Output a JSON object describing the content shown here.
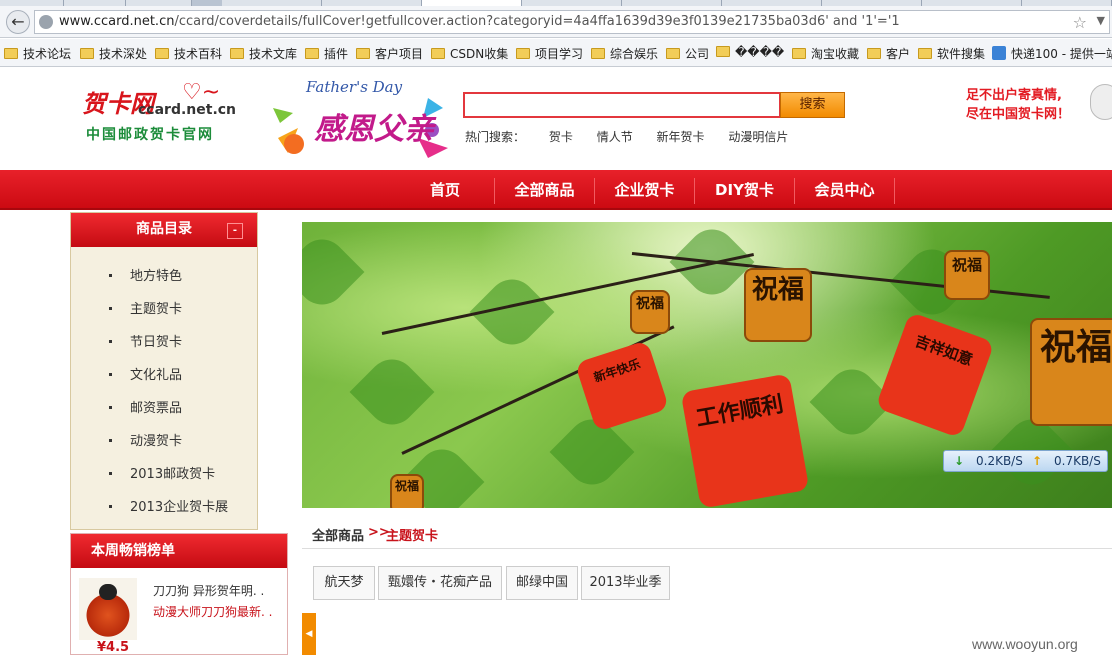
{
  "browser": {
    "url_host": "www.ccard.net.cn",
    "url_path": "/ccard/coverdetails/fullCover!getfullcover.action?categoryid=4a4ffa1639d39e3f0139e21735ba03d6'  and '1'='1"
  },
  "bookmarks": [
    {
      "label": "技术论坛",
      "icon": "folder-icon"
    },
    {
      "label": "技术深处",
      "icon": "folder-icon"
    },
    {
      "label": "技术百科",
      "icon": "folder-icon"
    },
    {
      "label": "技术文库",
      "icon": "folder-icon"
    },
    {
      "label": "插件",
      "icon": "folder-icon"
    },
    {
      "label": "客户项目",
      "icon": "folder-icon"
    },
    {
      "label": "CSDN收集",
      "icon": "folder-icon"
    },
    {
      "label": "项目学习",
      "icon": "folder-icon"
    },
    {
      "label": "综合娱乐",
      "icon": "folder-icon"
    },
    {
      "label": "公司",
      "icon": "folder-icon"
    },
    {
      "label": "����",
      "icon": "folder-icon"
    },
    {
      "label": "淘宝收藏",
      "icon": "folder-icon"
    },
    {
      "label": "客户",
      "icon": "folder-icon"
    },
    {
      "label": "软件搜集",
      "icon": "folder-icon"
    },
    {
      "label": "快递100 - 提供一站",
      "icon": "page-icon"
    }
  ],
  "header": {
    "logo_main": "贺卡网",
    "logo_url": "ccard.net.cn",
    "logo_sub": "中国邮政贺卡官网",
    "promo_title": "Father's Day",
    "promo_cn": "感恩父亲",
    "search_button": "搜索",
    "search_value": "",
    "hot_label": "热门搜索：",
    "hot_links": [
      "贺卡",
      "情人节",
      "新年贺卡",
      "动漫明信片"
    ],
    "slogan_line1": "足不出户寄真情,",
    "slogan_line2": "尽在中国贺卡网！"
  },
  "nav": [
    "首页",
    "全部商品",
    "企业贺卡",
    "DIY贺卡",
    "会员中心"
  ],
  "categories": {
    "title": "商品目录",
    "toggle": "-",
    "items": [
      "地方特色",
      "主题贺卡",
      "节日贺卡",
      "文化礼品",
      "邮资票品",
      "动漫贺卡",
      "2013邮政贺卡",
      "2013企业贺卡展"
    ]
  },
  "bestsellers": {
    "title": "本周畅销榜单",
    "item_title": "刀刀狗  异形贺年明. .",
    "item_desc": "动漫大师刀刀狗最新. .",
    "item_price": "¥4.5"
  },
  "banner": {
    "plaques": [
      "祝福",
      "祝福",
      "祝福",
      "祝福",
      "祝福"
    ],
    "ribbons": [
      "新年快乐",
      "工作顺利",
      "吉祥如意"
    ]
  },
  "speed": {
    "down": "0.2KB/S",
    "up": "0.7KB/S"
  },
  "breadcrumb": {
    "root": "全部商品",
    "sep": ">>",
    "current": "主题贺卡"
  },
  "tags": [
    "航天梦",
    "甄嬛传・花痴产品",
    "邮绿中国",
    "2013毕业季"
  ],
  "watermark": "www.wooyun.org",
  "colors": {
    "brand_red": "#d8151c",
    "nav_red": "#e31b23",
    "search_orange": "#f28b00",
    "green": "#1c8c3a"
  }
}
